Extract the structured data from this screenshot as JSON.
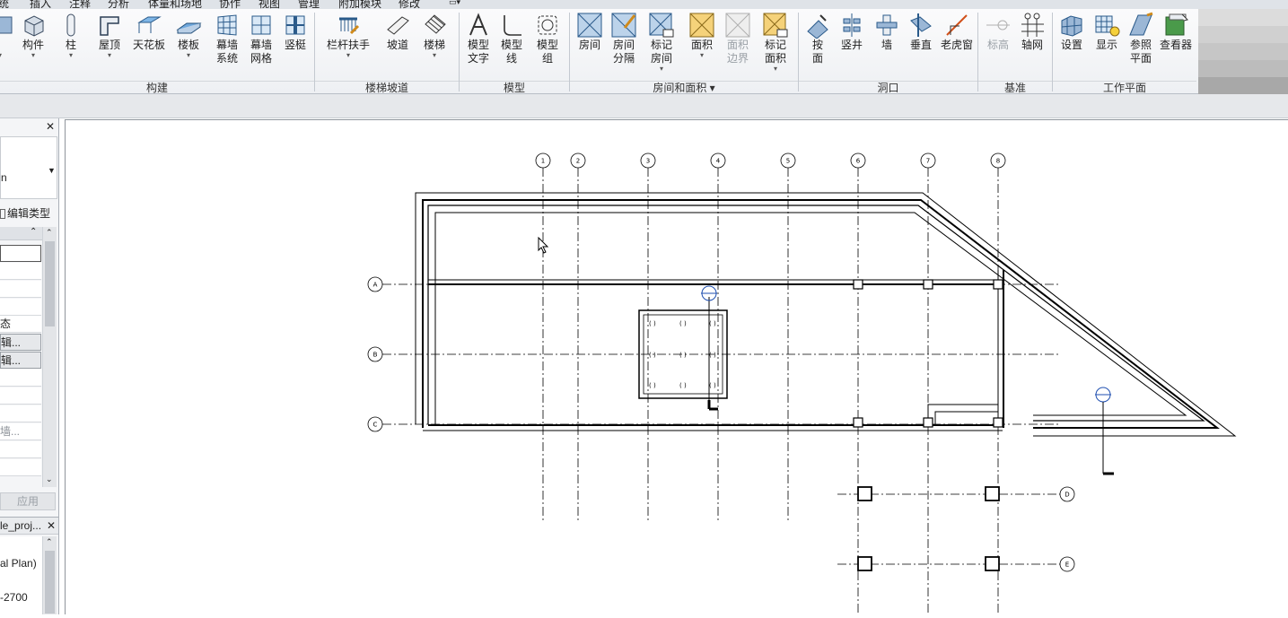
{
  "menubar": {
    "items": [
      "统",
      "插入",
      "注释",
      "分析",
      "体量和场地",
      "协作",
      "视图",
      "管理",
      "附加模块",
      "修改"
    ]
  },
  "ribbon": {
    "groups": {
      "build": "构建",
      "stairs": "楼梯坡道",
      "model": "模型",
      "room": "房间和面积 ▾",
      "opening": "洞口",
      "datum": "基准",
      "workplane": "工作平面"
    },
    "tools": {
      "component": "构件",
      "column": "柱",
      "roof": "屋顶",
      "ceiling": "天花板",
      "floor": "楼板",
      "curtain_system": "幕墙\n系统",
      "curtain_grid": "幕墙\n网格",
      "mullion": "竖梃",
      "railing": "栏杆扶手",
      "ramp": "坡道",
      "stair": "楼梯",
      "model_text": "模型\n文字",
      "model_line": "模型\n线",
      "model_group": "模型\n组",
      "room": "房间",
      "room_separator": "房间\n分隔",
      "tag_room": "标记\n房间",
      "area": "面积",
      "area_boundary": "面积\n边界",
      "tag_area": "标记\n面积",
      "by_face": "按\n面",
      "shaft": "竖井",
      "wall_opening": "墙",
      "vertical": "垂直",
      "dormer": "老虎窗",
      "level": "标高",
      "grid": "轴网",
      "set": "设置",
      "show": "显示",
      "ref_plane": "参照\n平面",
      "viewer": "查看器"
    }
  },
  "properties": {
    "type_value": "n",
    "edit_type": "编辑类型",
    "state": "态",
    "edit1": "辑...",
    "edit2": "辑...",
    "wall_ellipsis": "墙...",
    "apply": "应用"
  },
  "browser": {
    "title": "le_proj...",
    "item1": "al Plan)",
    "item2": "-2700"
  },
  "drawing": {
    "grid_columns": [
      "1",
      "2",
      "3",
      "4",
      "5",
      "6",
      "7",
      "8"
    ],
    "grid_rows": [
      "A",
      "B",
      "C",
      "D",
      "E"
    ]
  }
}
